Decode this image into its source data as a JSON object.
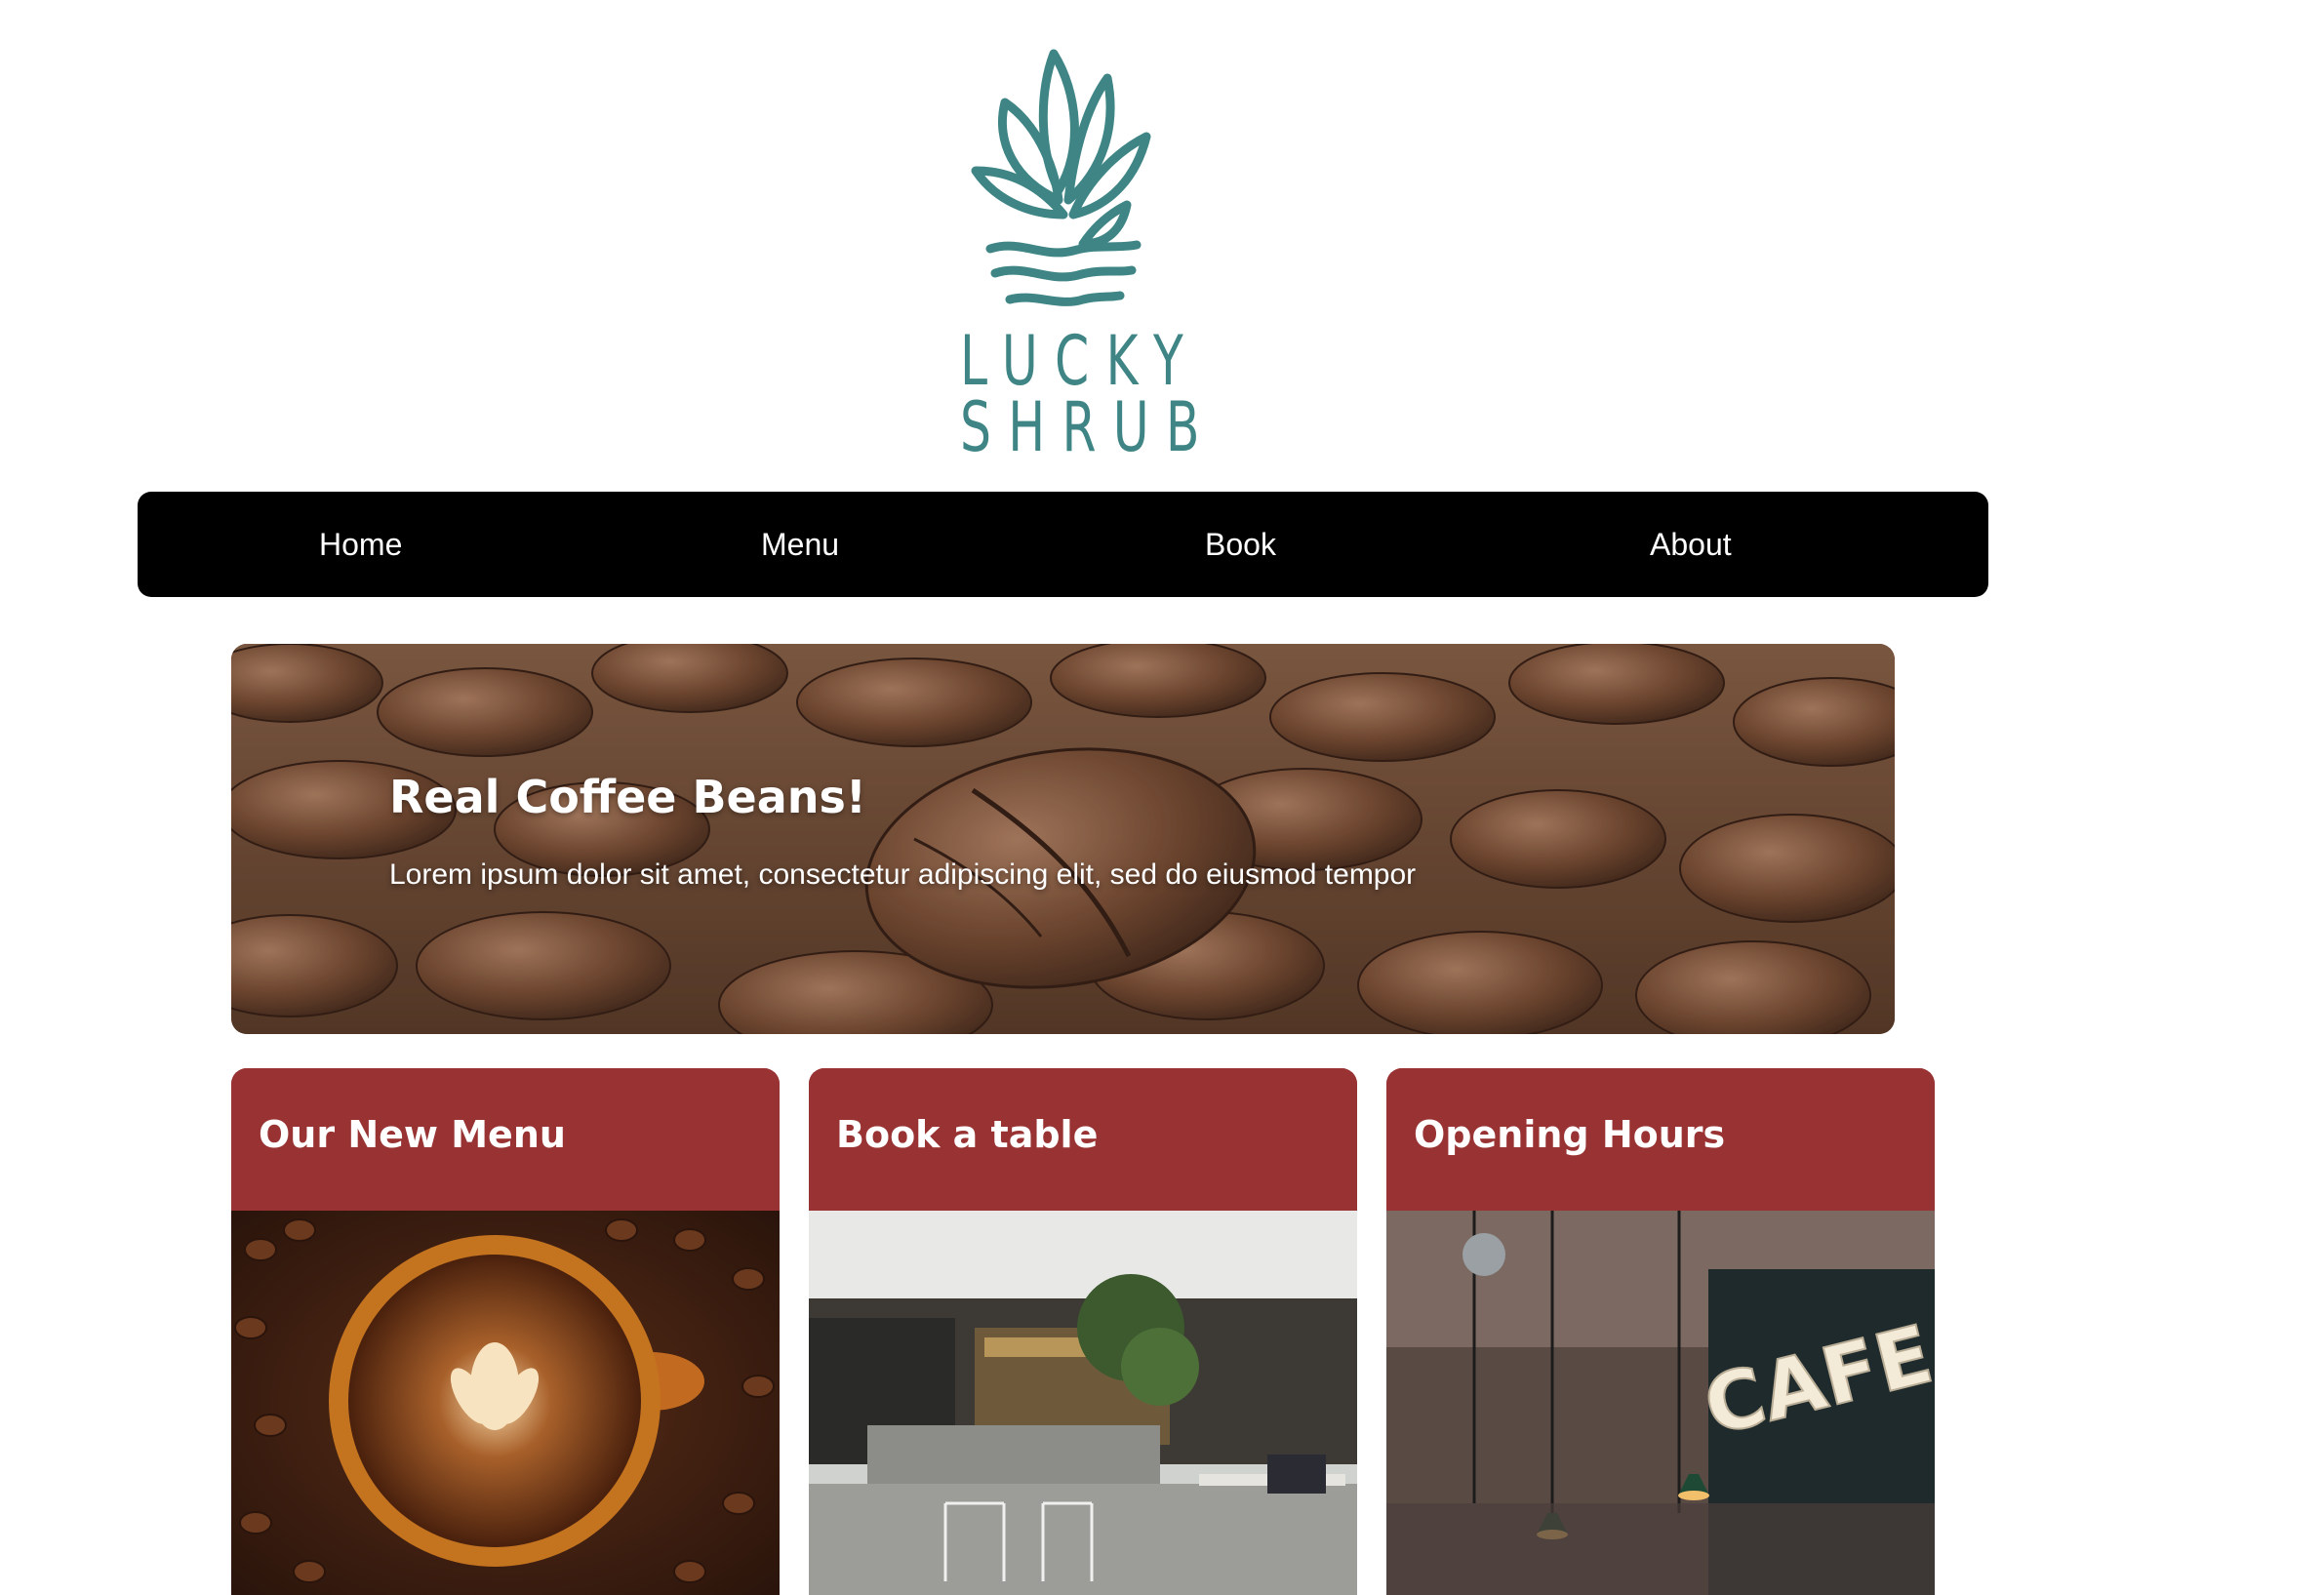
{
  "logo": {
    "line1": "LUCKY",
    "line2": "SHRUB",
    "color": "#3f8585"
  },
  "nav": {
    "background": "#000000",
    "items": [
      {
        "label": "Home"
      },
      {
        "label": "Menu"
      },
      {
        "label": "Book"
      },
      {
        "label": "About"
      }
    ]
  },
  "hero": {
    "title": "Real Coffee Beans!",
    "text": "Lorem ipsum dolor sit amet, consectetur adipiscing elit, sed do eiusmod tempor"
  },
  "cards": [
    {
      "title": "Our New Menu",
      "image": "latte-on-coffee-beans"
    },
    {
      "title": "Book a table",
      "image": "cafe-interior"
    },
    {
      "title": "Opening Hours",
      "image": "cafe-neon-sign"
    }
  ],
  "colors": {
    "card_header": "#993333",
    "text_on_dark": "#ffffff"
  }
}
